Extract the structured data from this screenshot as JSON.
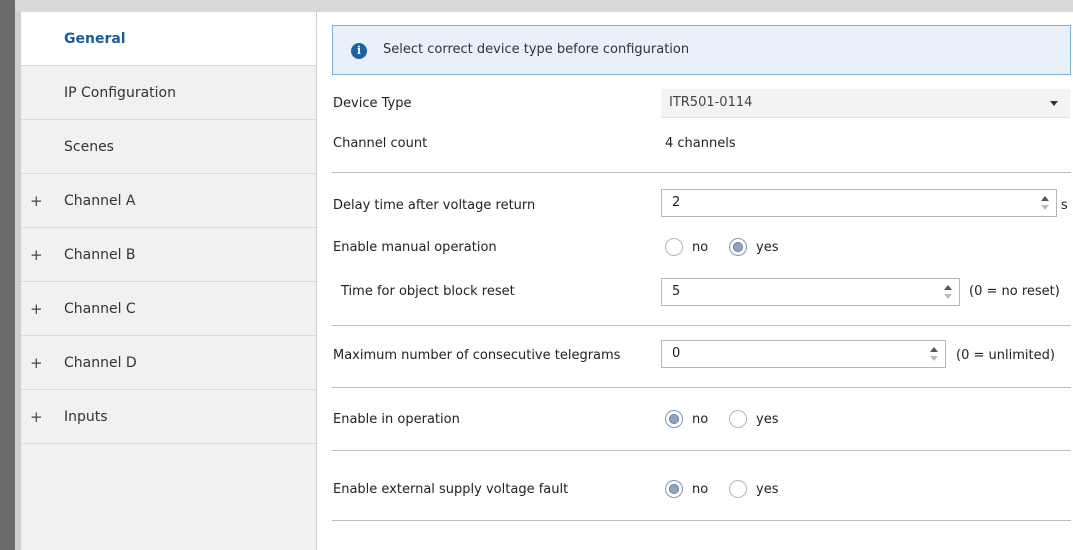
{
  "info_banner": {
    "message": "Select correct device type before configuration"
  },
  "sidebar": {
    "items": [
      {
        "label": "General",
        "expandable": false,
        "active": true
      },
      {
        "label": "IP Configuration",
        "expandable": false,
        "active": false
      },
      {
        "label": "Scenes",
        "expandable": false,
        "active": false
      },
      {
        "label": "Channel A",
        "expandable": true,
        "active": false
      },
      {
        "label": "Channel B",
        "expandable": true,
        "active": false
      },
      {
        "label": "Channel C",
        "expandable": true,
        "active": false
      },
      {
        "label": "Channel D",
        "expandable": true,
        "active": false
      },
      {
        "label": "Inputs",
        "expandable": true,
        "active": false
      }
    ],
    "plus_symbol": "+"
  },
  "device_type": {
    "label": "Device Type",
    "value": "ITR501-0114"
  },
  "channel_count": {
    "label": "Channel count",
    "value": "4 channels"
  },
  "delay_time": {
    "label": "Delay time after voltage return",
    "value": "2",
    "unit": "s"
  },
  "manual_operation": {
    "label": "Enable manual operation",
    "selected": "yes"
  },
  "block_reset": {
    "label": "Time for object block reset",
    "value": "5",
    "unit": "(0 = no reset)"
  },
  "max_telegrams": {
    "label": "Maximum number of consecutive telegrams",
    "value": "0",
    "unit": "(0 = unlimited)"
  },
  "in_operation": {
    "label": "Enable in operation",
    "selected": "no"
  },
  "supply_fault": {
    "label": "Enable external supply voltage fault",
    "selected": "no"
  },
  "radio_labels": {
    "no": "no",
    "yes": "yes"
  },
  "colors": {
    "active_text": "#1a5d9a",
    "info_bg": "#e8f1f9",
    "info_border": "#7fb0d8",
    "info_icon": "#1d62a6"
  },
  "icons": {
    "info": "info-icon",
    "dropdown": "chevron-down-icon",
    "spinner": "spinner-icon"
  }
}
